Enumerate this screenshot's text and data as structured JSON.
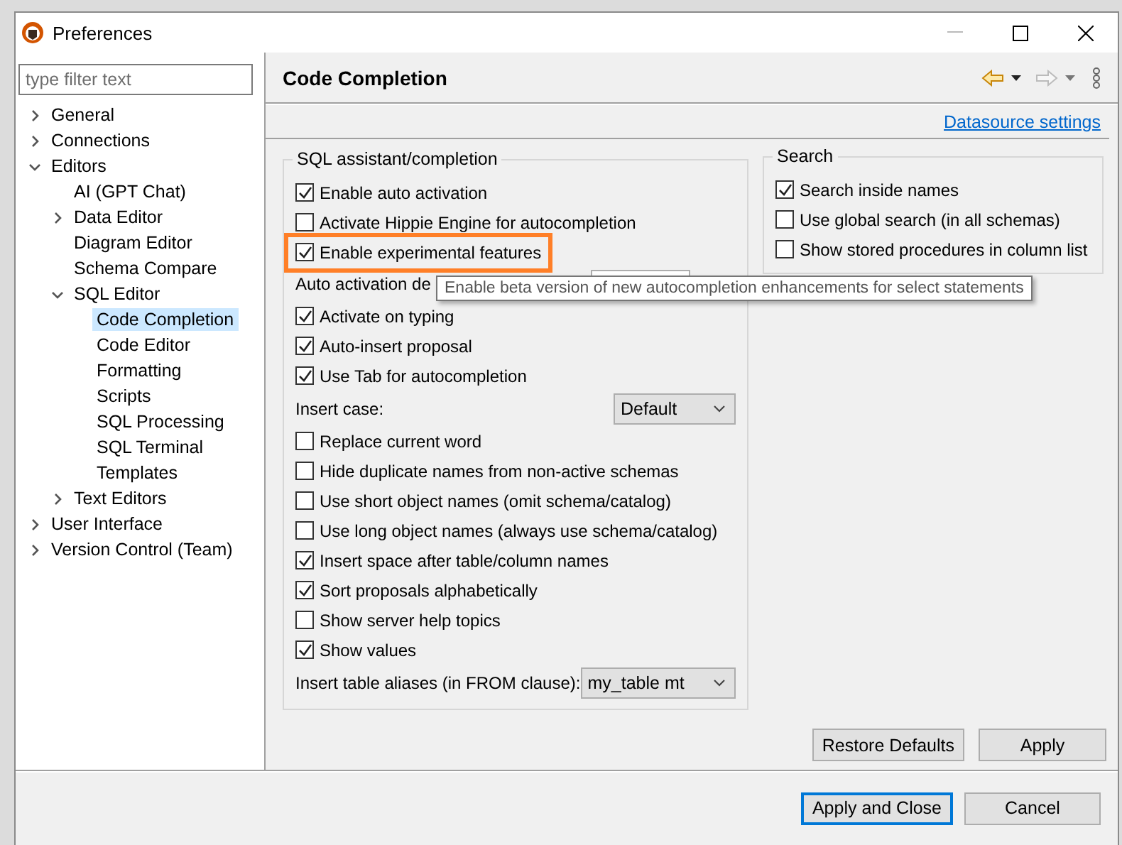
{
  "window": {
    "title": "Preferences"
  },
  "filter": {
    "placeholder": "type filter text"
  },
  "tree": [
    {
      "label": "General",
      "kind": "branch",
      "expanded": false,
      "selected": false
    },
    {
      "label": "Connections",
      "kind": "branch",
      "expanded": false,
      "selected": false
    },
    {
      "label": "Editors",
      "kind": "branch",
      "expanded": true,
      "selected": false,
      "children": [
        {
          "label": "AI (GPT Chat)",
          "kind": "leaf",
          "selected": false
        },
        {
          "label": "Data Editor",
          "kind": "branch",
          "expanded": false,
          "selected": false
        },
        {
          "label": "Diagram Editor",
          "kind": "leaf",
          "selected": false
        },
        {
          "label": "Schema Compare",
          "kind": "leaf",
          "selected": false
        },
        {
          "label": "SQL Editor",
          "kind": "branch",
          "expanded": true,
          "selected": false,
          "children": [
            {
              "label": "Code Completion",
              "kind": "leaf",
              "selected": true
            },
            {
              "label": "Code Editor",
              "kind": "leaf",
              "selected": false
            },
            {
              "label": "Formatting",
              "kind": "leaf",
              "selected": false
            },
            {
              "label": "Scripts",
              "kind": "leaf",
              "selected": false
            },
            {
              "label": "SQL Processing",
              "kind": "leaf",
              "selected": false
            },
            {
              "label": "SQL Terminal",
              "kind": "leaf",
              "selected": false
            },
            {
              "label": "Templates",
              "kind": "leaf",
              "selected": false
            }
          ]
        },
        {
          "label": "Text Editors",
          "kind": "branch",
          "expanded": false,
          "selected": false
        }
      ]
    },
    {
      "label": "User Interface",
      "kind": "branch",
      "expanded": false,
      "selected": false
    },
    {
      "label": "Version Control (Team)",
      "kind": "branch",
      "expanded": false,
      "selected": false
    }
  ],
  "page": {
    "title": "Code Completion",
    "link": "Datasource settings"
  },
  "assistant": {
    "title": "SQL assistant/completion",
    "rows": [
      {
        "kind": "checkbox",
        "label": "Enable auto activation",
        "checked": true,
        "highlighted": false
      },
      {
        "kind": "checkbox",
        "label": "Activate Hippie Engine for autocompletion",
        "checked": false,
        "highlighted": false
      },
      {
        "kind": "checkbox",
        "label": "Enable experimental features",
        "checked": true,
        "highlighted": true
      },
      {
        "kind": "spinner",
        "label": "Auto activation de"
      },
      {
        "kind": "checkbox",
        "label": "Activate on typing",
        "checked": true,
        "highlighted": false
      },
      {
        "kind": "checkbox",
        "label": "Auto-insert proposal",
        "checked": true,
        "highlighted": false
      },
      {
        "kind": "checkbox",
        "label": "Use Tab for autocompletion",
        "checked": true,
        "highlighted": false
      },
      {
        "kind": "select",
        "label": "Insert case:",
        "value": "Default",
        "wide": false
      },
      {
        "kind": "checkbox",
        "label": "Replace current word",
        "checked": false,
        "highlighted": false
      },
      {
        "kind": "checkbox",
        "label": "Hide duplicate names from non-active schemas",
        "checked": false,
        "highlighted": false
      },
      {
        "kind": "checkbox",
        "label": "Use short object names (omit schema/catalog)",
        "checked": false,
        "highlighted": false
      },
      {
        "kind": "checkbox",
        "label": "Use long object names (always use schema/catalog)",
        "checked": false,
        "highlighted": false
      },
      {
        "kind": "checkbox",
        "label": "Insert space after table/column names",
        "checked": true,
        "highlighted": false
      },
      {
        "kind": "checkbox",
        "label": "Sort proposals alphabetically",
        "checked": true,
        "highlighted": false
      },
      {
        "kind": "checkbox",
        "label": "Show server help topics",
        "checked": false,
        "highlighted": false
      },
      {
        "kind": "checkbox",
        "label": "Show values",
        "checked": true,
        "highlighted": false
      },
      {
        "kind": "select",
        "label": "Insert table aliases (in FROM clause):",
        "value": "my_table mt",
        "wide": true
      }
    ]
  },
  "search": {
    "title": "Search",
    "rows": [
      {
        "label": "Search inside names",
        "checked": true
      },
      {
        "label": "Use global search (in all schemas)",
        "checked": false
      },
      {
        "label": "Show stored procedures in column list",
        "checked": false
      }
    ]
  },
  "tooltip": "Enable beta version of new autocompletion enhancements for select statements",
  "page_buttons": [
    "Restore Defaults",
    "Apply"
  ],
  "dialog_buttons": [
    {
      "label": "Apply and Close",
      "default": true
    },
    {
      "label": "Cancel",
      "default": false
    }
  ]
}
